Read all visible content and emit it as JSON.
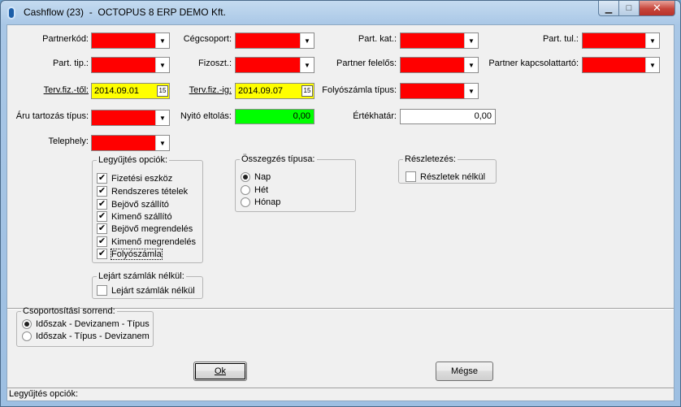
{
  "window": {
    "title": "Cashflow (23)  -  OCTOPUS 8 ERP DEMO Kft.",
    "min_glyph": "▁",
    "max_glyph": "□",
    "close_glyph": "✕"
  },
  "fields": {
    "partnerkod": "Partnerkód:",
    "cegcsoport": "Cégcsoport:",
    "part_kat": "Part. kat.:",
    "part_tul": "Part. tul.:",
    "part_tip": "Part. tip.:",
    "fizoszt": "Fizoszt.:",
    "partner_felelos": "Partner felelős:",
    "partner_kapcsolattarto": "Partner kapcsolattartó:",
    "terv_fiz_tol": "Terv.fiz.-től:",
    "terv_fiz_tol_value": "2014.09.01",
    "terv_fiz_ig": "Terv.fiz.-ig:",
    "terv_fiz_ig_value": "2014.09.07",
    "folyoszamla_tipus": "Folyószámla típus:",
    "aru_tartozas_tipus": "Áru tartozás típus:",
    "nyito_egyenleg": "Nyitó eltolás:",
    "nyito_egyenleg_value": "0,00",
    "ertekhatar": "Értékhatár:",
    "ertekhatar_value": "0,00",
    "telephely": "Telephely:",
    "cal_glyph": "15",
    "arrow_glyph": "▼"
  },
  "gyujtes": {
    "legend": "Legyűjtés opciók:",
    "items": [
      {
        "label": "Fizetési eszköz",
        "checked": true
      },
      {
        "label": "Rendszeres tételek",
        "checked": true
      },
      {
        "label": "Bejövő szállító",
        "checked": true
      },
      {
        "label": "Kimenő szállító",
        "checked": true
      },
      {
        "label": "Bejövő megrendelés",
        "checked": true
      },
      {
        "label": "Kimenő megrendelés",
        "checked": true
      },
      {
        "label": "Folyószámla",
        "checked": true
      }
    ],
    "check_glyph": "✔"
  },
  "osszegzes": {
    "legend": "Összegzés típusa:",
    "options": [
      {
        "label": "Nap",
        "selected": true
      },
      {
        "label": "Hét",
        "selected": false
      },
      {
        "label": "Hónap",
        "selected": false
      }
    ]
  },
  "reszletezes": {
    "legend": "Részletezés:",
    "item": "Részletek nélkül"
  },
  "lejart": {
    "legend": "Lejárt számlák nélkül:",
    "item": "Lejárt számlák nélkül"
  },
  "csoport": {
    "legend": "Csoportosítási sorrend:",
    "options": [
      {
        "label": "Időszak - Devizanem - Típus",
        "selected": true
      },
      {
        "label": "Időszak - Típus - Devizanem",
        "selected": false
      }
    ]
  },
  "buttons": {
    "ok": "Ok",
    "megse": "Mégse"
  },
  "status": {
    "text": "Legyűjtés opciók:"
  },
  "colors": {
    "required": "#ff0000",
    "date": "#ffff00",
    "readonly": "#00ff00"
  }
}
